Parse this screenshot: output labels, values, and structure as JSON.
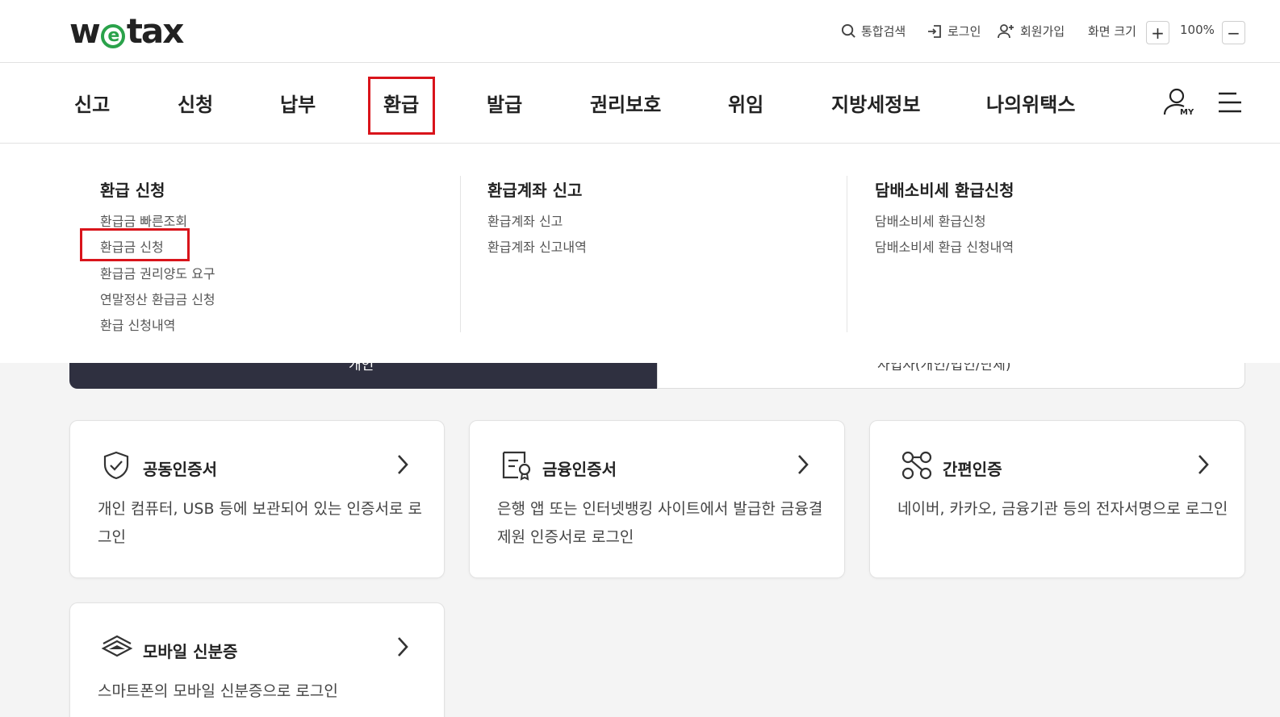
{
  "header": {
    "logo_text_1": "w",
    "logo_text_2": "e",
    "logo_text_3": "tax",
    "search_label": "통합검색",
    "login_label": "로그인",
    "signup_label": "회원가입",
    "zoom_label": "화면 크기",
    "zoom_value": "100%",
    "zoom_in": "+",
    "zoom_out": "−"
  },
  "nav": {
    "items": [
      {
        "label": "신고"
      },
      {
        "label": "신청"
      },
      {
        "label": "납부"
      },
      {
        "label": "환급"
      },
      {
        "label": "발급"
      },
      {
        "label": "권리보호"
      },
      {
        "label": "위임"
      },
      {
        "label": "지방세정보"
      },
      {
        "label": "나의위택스"
      }
    ],
    "my_label": "MY"
  },
  "mega_menu": {
    "columns": [
      {
        "title": "환급 신청",
        "links": [
          "환급금 빠른조회",
          "환급금 신청",
          "환급금 권리양도 요구",
          "연말정산 환급금 신청",
          "환급 신청내역"
        ]
      },
      {
        "title": "환급계좌 신고",
        "links": [
          "환급계좌 신고",
          "환급계좌 신고내역"
        ]
      },
      {
        "title": "담배소비세 환급신청",
        "links": [
          "담배소비세 환급신청",
          "담배소비세 환급 신청내역"
        ]
      }
    ]
  },
  "tabs": {
    "individual": "개인",
    "business": "사업자(개인/법인/단체)"
  },
  "login_methods": [
    {
      "title": "공동인증서",
      "desc": "개인 컴퓨터, USB 등에 보관되어 있는 인증서로 로그인",
      "icon": "shield-check-icon"
    },
    {
      "title": "금융인증서",
      "desc": "은행 앱 또는 인터넷뱅킹 사이트에서 발급한 금융결제원 인증서로 로그인",
      "icon": "certificate-icon"
    },
    {
      "title": "간편인증",
      "desc": "네이버, 카카오, 금융기관 등의 전자서명으로 로그인",
      "icon": "nodes-icon"
    },
    {
      "title": "모바일 신분증",
      "desc": "스마트폰의 모바일 신분증으로 로그인",
      "icon": "id-card-stack-icon"
    }
  ],
  "colors": {
    "highlight": "#d9141b",
    "logo_green": "#2aa24a",
    "dark_tab": "#2f3040"
  }
}
